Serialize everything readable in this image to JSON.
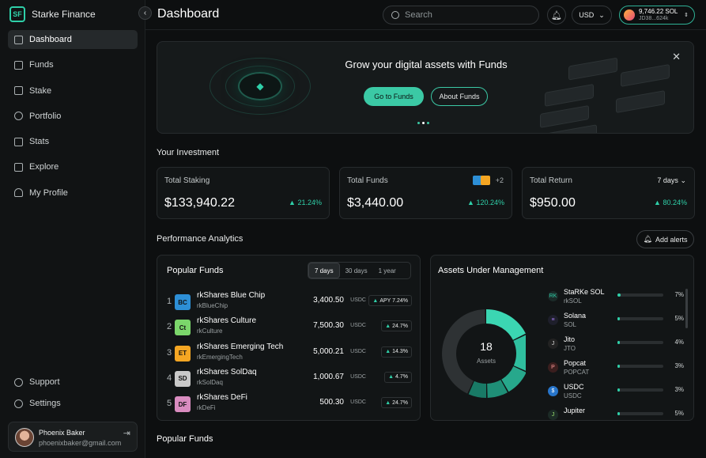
{
  "brand": {
    "name": "Starke Finance",
    "logo_text": "SF"
  },
  "sidebar": {
    "items": [
      {
        "label": "Dashboard",
        "icon": "home-icon",
        "active": true
      },
      {
        "label": "Funds",
        "icon": "funds-icon"
      },
      {
        "label": "Stake",
        "icon": "stake-icon"
      },
      {
        "label": "Portfolio",
        "icon": "portfolio-icon"
      },
      {
        "label": "Stats",
        "icon": "stats-icon"
      },
      {
        "label": "Explore",
        "icon": "explore-icon"
      },
      {
        "label": "My Profile",
        "icon": "profile-icon"
      }
    ],
    "bottom": [
      {
        "label": "Support",
        "icon": "support-icon"
      },
      {
        "label": "Settings",
        "icon": "gear-icon"
      }
    ],
    "profile": {
      "name": "Phoenix Baker",
      "email": "phoenixbaker@gmail.com"
    }
  },
  "header": {
    "title": "Dashboard",
    "search_placeholder": "Search",
    "currency": "USD",
    "wallet_amount": "9,746.22 SOL",
    "wallet_address": "JD38...624k"
  },
  "banner": {
    "title": "Grow your digital assets with Funds",
    "primary": "Go to Funds",
    "secondary": "About Funds"
  },
  "investment": {
    "title": "Your Investment",
    "staking": {
      "label": "Total Staking",
      "value": "$133,940.22",
      "change": "21.24%"
    },
    "funds": {
      "label": "Total Funds",
      "value": "$3,440.00",
      "change": "120.24%",
      "more": "+2"
    },
    "ret": {
      "label": "Total Return",
      "value": "$950.00",
      "change": "80.24%",
      "range": "7 days"
    }
  },
  "performance": {
    "title": "Performance Analytics",
    "alerts": "Add alerts"
  },
  "popular": {
    "title": "Popular Funds",
    "tabs": [
      "7 days",
      "30 days",
      "1 year"
    ],
    "rows": [
      {
        "n": "1",
        "logo": "BC",
        "color": "#2d8fd6",
        "name": "rkShares Blue Chip",
        "ticker": "rkBlueChip",
        "value": "3,400.50",
        "cur": "USDC",
        "chg": "APY 7.24%"
      },
      {
        "n": "2",
        "logo": "Ct",
        "color": "#7bd66b",
        "name": "rkShares Culture",
        "ticker": "rkCulture",
        "value": "7,500.30",
        "cur": "USDC",
        "chg": "24.7%"
      },
      {
        "n": "3",
        "logo": "ET",
        "color": "#f5a623",
        "name": "rkShares Emerging Tech",
        "ticker": "rkEmergingTech",
        "value": "5,000.21",
        "cur": "USDC",
        "chg": "14.3%"
      },
      {
        "n": "4",
        "logo": "SD",
        "color": "#c9c9c9",
        "name": "rkShares SolDaq",
        "ticker": "rkSolDaq",
        "value": "1,000.67",
        "cur": "USDC",
        "chg": "4.7%"
      },
      {
        "n": "5",
        "logo": "DF",
        "color": "#d98cc0",
        "name": "rkShares DeFi",
        "ticker": "rkDeFi",
        "value": "500.30",
        "cur": "USDC",
        "chg": "24.7%"
      }
    ]
  },
  "aum": {
    "title": "Assets Under Management",
    "count": "18",
    "count_label": "Assets",
    "assets": [
      {
        "name": "StaRKe SOL",
        "ticker": "rkSOL",
        "pct": "7%",
        "fill": 0.07,
        "icon": "RK",
        "bg": "#1b2a28",
        "fg": "#2fd0a9"
      },
      {
        "name": "Solana",
        "ticker": "SOL",
        "pct": "5%",
        "fill": 0.05,
        "icon": "≡",
        "bg": "#1e1f2b",
        "fg": "#a77bf3"
      },
      {
        "name": "Jito",
        "ticker": "JTO",
        "pct": "4%",
        "fill": 0.04,
        "icon": "J",
        "bg": "#222",
        "fg": "#ddd"
      },
      {
        "name": "Popcat",
        "ticker": "POPCAT",
        "pct": "3%",
        "fill": 0.03,
        "icon": "P",
        "bg": "#3a1e1e",
        "fg": "#ff9a9a"
      },
      {
        "name": "USDC",
        "ticker": "USDC",
        "pct": "3%",
        "fill": 0.03,
        "icon": "$",
        "bg": "#2775ca",
        "fg": "#fff"
      },
      {
        "name": "Jupiter",
        "ticker": "",
        "pct": "5%",
        "fill": 0.05,
        "icon": "J",
        "bg": "#1c2b26",
        "fg": "#9fe870"
      }
    ],
    "segments": [
      0.18,
      0.14,
      0.1,
      0.08,
      0.07,
      0.43
    ]
  },
  "popular2": {
    "title": "Popular Funds"
  }
}
